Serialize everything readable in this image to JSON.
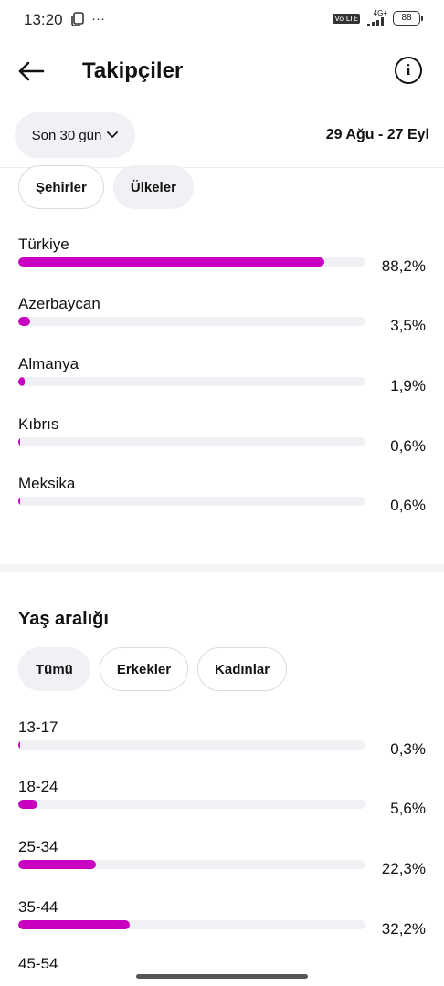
{
  "status": {
    "time": "13:20",
    "network": "4G+",
    "volte": "Vo LTE",
    "battery": "88"
  },
  "header": {
    "title": "Takipçiler"
  },
  "range": {
    "selector_label": "Son 30 gün",
    "date_range": "29 Ağu - 27 Eyl"
  },
  "locations": {
    "chips": [
      {
        "label": "Şehirler",
        "active": false
      },
      {
        "label": "Ülkeler",
        "active": true
      }
    ],
    "rows": [
      {
        "label": "Türkiye",
        "value": "88,2%",
        "percent": 88.2
      },
      {
        "label": "Azerbaycan",
        "value": "3,5%",
        "percent": 3.5
      },
      {
        "label": "Almanya",
        "value": "1,9%",
        "percent": 1.9
      },
      {
        "label": "Kıbrıs",
        "value": "0,6%",
        "percent": 0.6
      },
      {
        "label": "Meksika",
        "value": "0,6%",
        "percent": 0.6
      }
    ]
  },
  "age": {
    "title": "Yaş aralığı",
    "chips": [
      {
        "label": "Tümü",
        "active": true
      },
      {
        "label": "Erkekler",
        "active": false
      },
      {
        "label": "Kadınlar",
        "active": false
      }
    ],
    "rows": [
      {
        "label": "13-17",
        "value": "0,3%",
        "percent": 0.3
      },
      {
        "label": "18-24",
        "value": "5,6%",
        "percent": 5.6
      },
      {
        "label": "25-34",
        "value": "22,3%",
        "percent": 22.3
      },
      {
        "label": "35-44",
        "value": "32,2%",
        "percent": 32.2
      },
      {
        "label": "45-54",
        "value": "",
        "percent": 0
      }
    ]
  },
  "colors": {
    "bar": "#c800c0",
    "track": "#eff1f4",
    "chip_bg": "#eff1f4"
  }
}
